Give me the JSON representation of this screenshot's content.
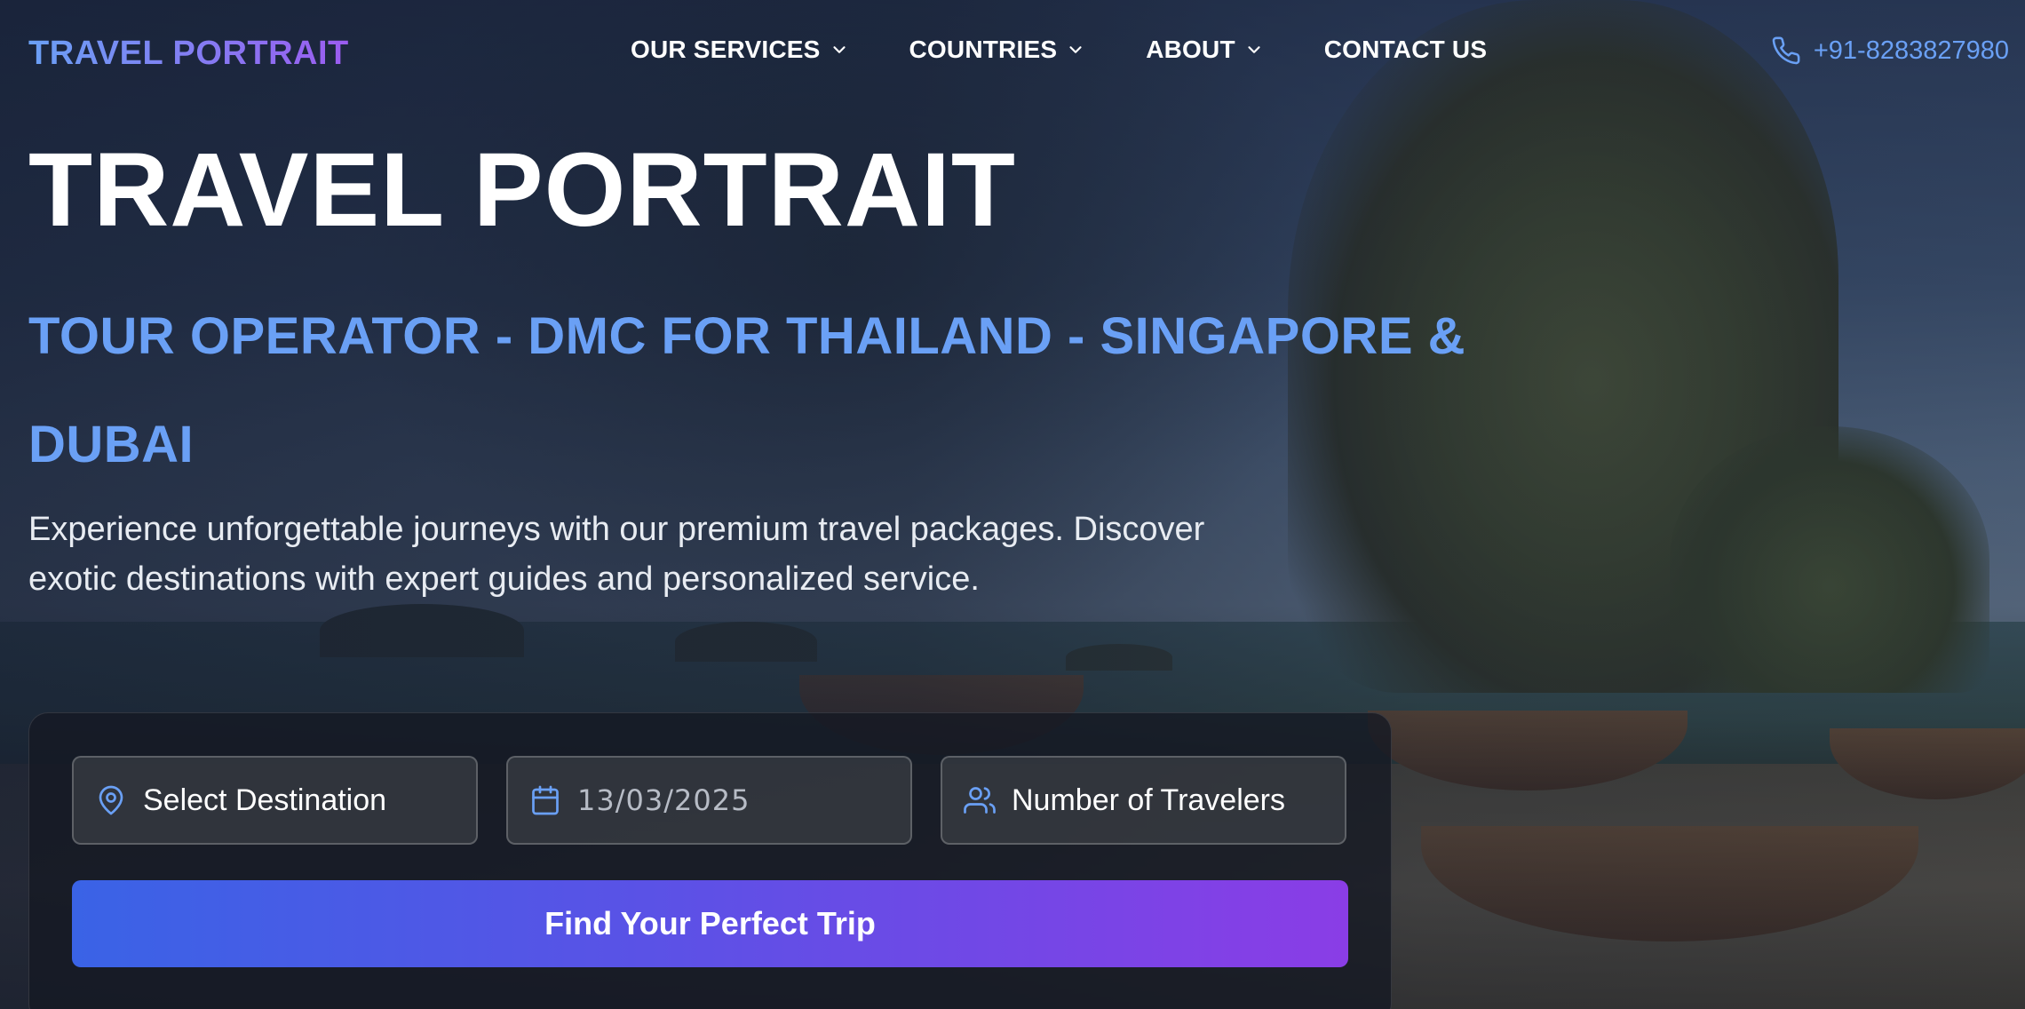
{
  "header": {
    "logo": "TRAVEL PORTRAIT",
    "menu": [
      {
        "label": "OUR SERVICES",
        "has_dropdown": true
      },
      {
        "label": "COUNTRIES",
        "has_dropdown": true
      },
      {
        "label": "ABOUT",
        "has_dropdown": true
      },
      {
        "label": "CONTACT US",
        "has_dropdown": false
      }
    ],
    "phone": "+91-8283827980",
    "phone_icon": "phone-icon"
  },
  "hero": {
    "title": "TRAVEL PORTRAIT",
    "subtitle": "TOUR OPERATOR - DMC FOR THAILAND - SINGAPORE & DUBAI",
    "description": "Experience unforgettable journeys with our premium travel packages. Discover exotic destinations with expert guides and personalized service."
  },
  "search": {
    "destination_label": "Select Destination",
    "destination_icon": "map-pin-icon",
    "date_value": "13/03/2025",
    "date_icon": "calendar-icon",
    "travelers_label": "Number of Travelers",
    "travelers_icon": "users-icon",
    "submit_label": "Find Your Perfect Trip"
  },
  "colors": {
    "accent_blue": "#6aa0f5",
    "accent_purple": "#9b5cf0",
    "button_start": "#3a63e6",
    "button_end": "#8a3de6"
  }
}
